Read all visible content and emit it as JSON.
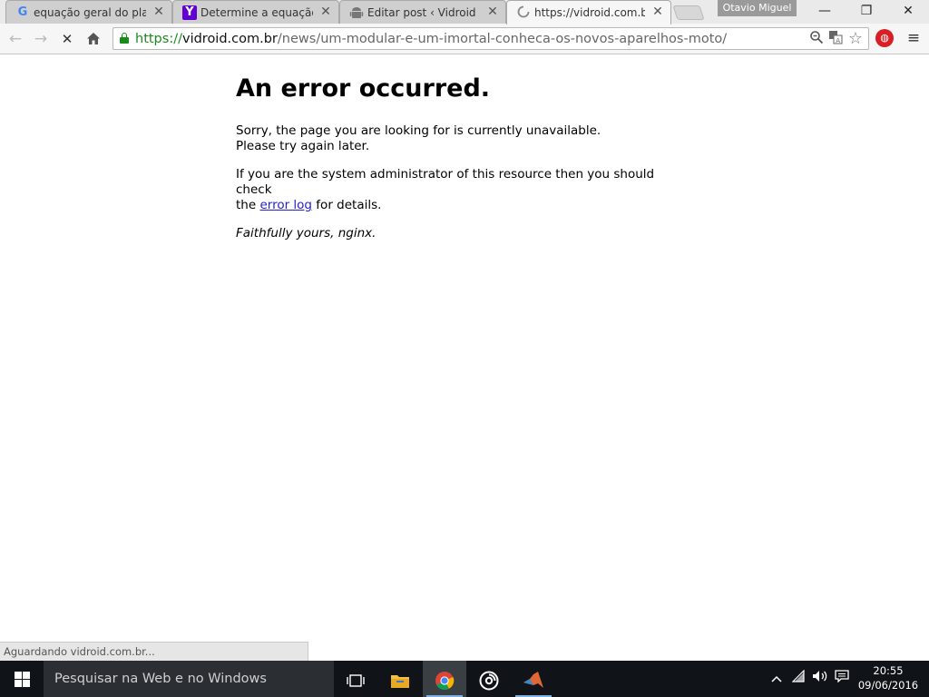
{
  "tabs": [
    {
      "title": "equação geral do plano",
      "favicon": "G",
      "favicon_color": "#4285f4",
      "active": false
    },
    {
      "title": "Determine a equação ge",
      "favicon": "Y",
      "favicon_color": "#6001d2",
      "active": false
    },
    {
      "title": "Editar post ‹ Vidroid — V",
      "favicon": "android-icon",
      "active": false
    },
    {
      "title": "https://vidroid.com.br/n",
      "favicon": "loading-spinner-icon",
      "active": true
    }
  ],
  "profile_name": "Otavio Miguel",
  "address_bar": {
    "scheme": "https://",
    "host": "vidroid.com.br",
    "path": "/news/um-modular-e-um-imortal-conheca-os-novos-aparelhos-moto/"
  },
  "page": {
    "heading": "An error occurred.",
    "line1": "Sorry, the page you are looking for is currently unavailable.",
    "line2": "Please try again later.",
    "admin_text_1": "If you are the system administrator of this resource then you should check",
    "admin_text_2": "the ",
    "error_log_link": "error log",
    "admin_text_3": " for details.",
    "signature": "Faithfully yours, nginx."
  },
  "status_text": "Aguardando vidroid.com.br...",
  "taskbar": {
    "search_placeholder": "Pesquisar na Web e no Windows",
    "time": "20:55",
    "date": "09/06/2016"
  },
  "colors": {
    "secure_green": "#1a8a1a",
    "link_blue": "#2222cc",
    "taskbar_bg": "#101418"
  }
}
